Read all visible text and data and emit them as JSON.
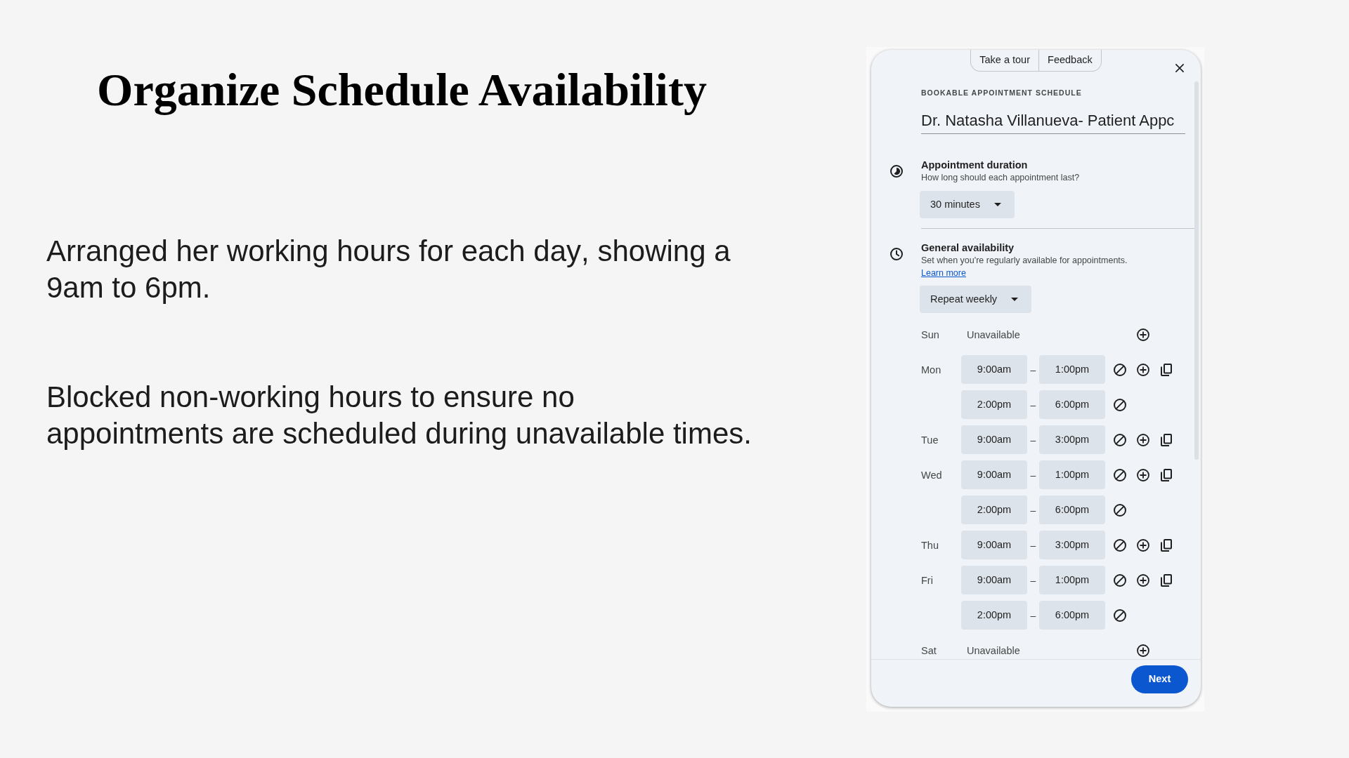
{
  "slide": {
    "title": "Organize Schedule Availability",
    "paragraphs": [
      "Arranged her working hours for each day, showing a 9am to 6pm.",
      "Blocked non-working hours to ensure no appointments are scheduled during unavailable times."
    ]
  },
  "panel": {
    "header_buttons": [
      "Take a tour",
      "Feedback"
    ],
    "overline": "BOOKABLE APPOINTMENT SCHEDULE",
    "schedule_name": {
      "value": "Dr. Natasha Villanueva- Patient Appc"
    },
    "sections": [
      {
        "kind": "duration",
        "title": "Appointment duration",
        "description": "How long should each appointment last?",
        "dropdown": "30 minutes"
      },
      {
        "kind": "availability",
        "title": "General availability",
        "description": "Set when you're regularly available for appointments.",
        "link": "Learn more",
        "dropdown": "Repeat weekly"
      }
    ],
    "days": [
      {
        "day": "Sun",
        "kind": "unavailable",
        "status": "Unavailable"
      },
      {
        "day": "Mon",
        "kind": "hours",
        "slots": [
          {
            "start": "9:00am",
            "dash": "–",
            "end": "1:00pm"
          },
          {
            "start": "2:00pm",
            "dash": "–",
            "end": "6:00pm"
          }
        ]
      },
      {
        "day": "Tue",
        "kind": "hours",
        "slots": [
          {
            "start": "9:00am",
            "dash": "–",
            "end": "3:00pm"
          }
        ]
      },
      {
        "day": "Wed",
        "kind": "hours",
        "slots": [
          {
            "start": "9:00am",
            "dash": "–",
            "end": "1:00pm"
          },
          {
            "start": "2:00pm",
            "dash": "–",
            "end": "6:00pm"
          }
        ]
      },
      {
        "day": "Thu",
        "kind": "hours",
        "slots": [
          {
            "start": "9:00am",
            "dash": "–",
            "end": "3:00pm"
          }
        ]
      },
      {
        "day": "Fri",
        "kind": "hours",
        "slots": [
          {
            "start": "9:00am",
            "dash": "–",
            "end": "1:00pm"
          },
          {
            "start": "2:00pm",
            "dash": "–",
            "end": "6:00pm"
          }
        ]
      },
      {
        "day": "Sat",
        "kind": "unavailable",
        "status": "Unavailable"
      }
    ],
    "primary_button": "Next"
  }
}
